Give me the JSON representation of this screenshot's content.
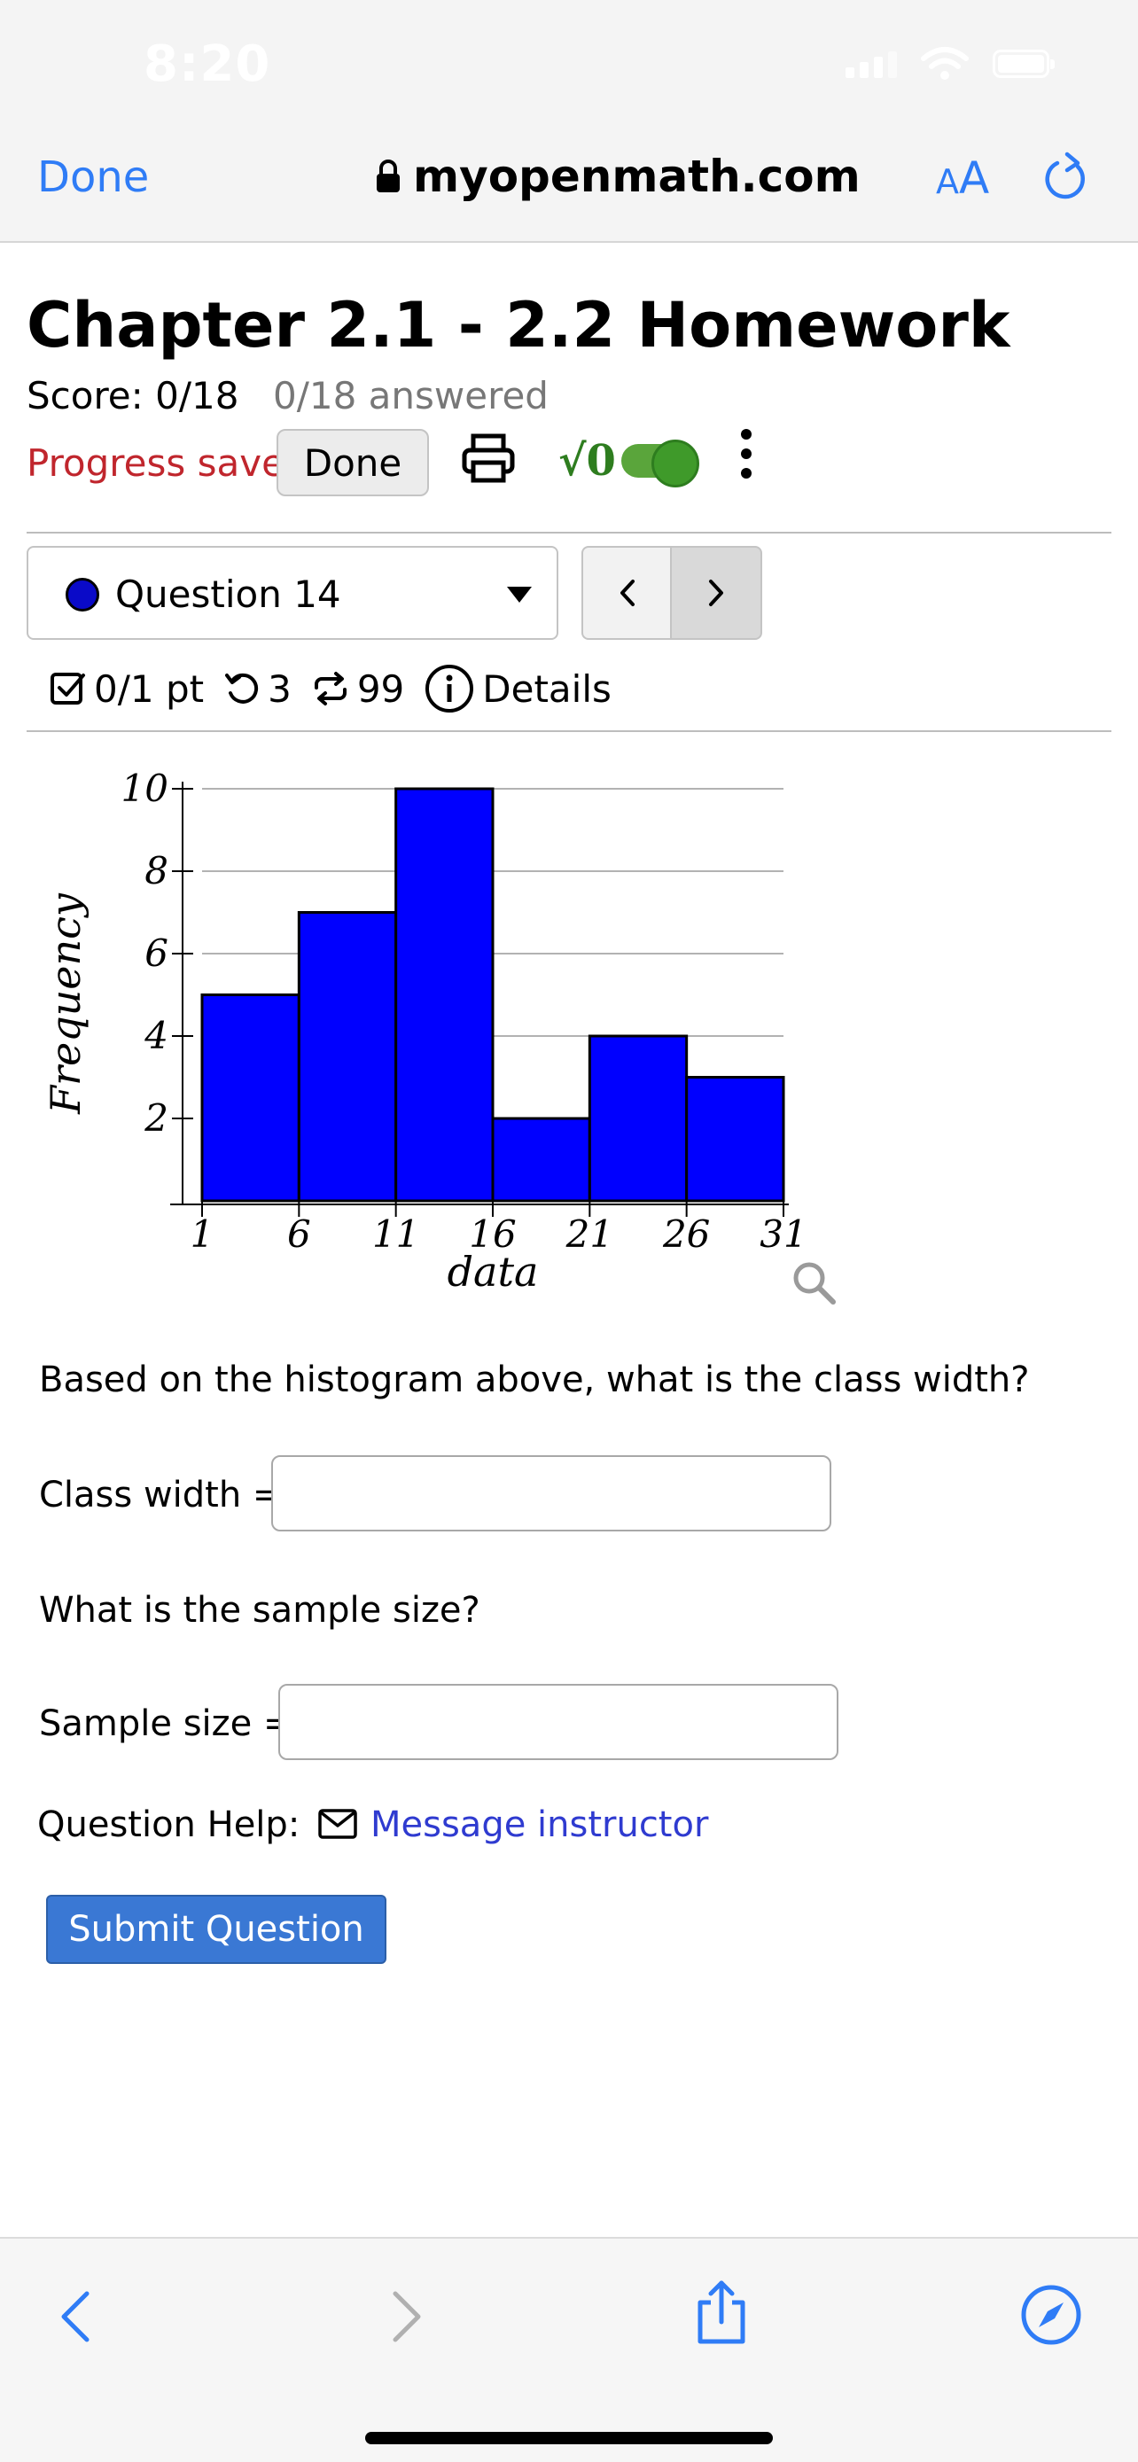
{
  "status_bar": {
    "time": "8:20"
  },
  "browser": {
    "done_label": "Done",
    "url": "myopenmath.com",
    "aa_small": "A",
    "aa_big": "A"
  },
  "page": {
    "title": "Chapter 2.1 - 2.2 Homework",
    "score": "Score: 0/18",
    "answered": "0/18 answered",
    "progress_saved": "Progress saved",
    "done_button": "Done"
  },
  "question_nav": {
    "current": "Question 14",
    "prev_symbol": "<",
    "next_symbol": ">"
  },
  "question_meta": {
    "points": "0/1 pt",
    "retries": "3",
    "attempts": "99",
    "details": "Details"
  },
  "chart_data": {
    "type": "bar",
    "title": "",
    "xlabel": "data",
    "ylabel": "Frequency",
    "bin_edges": [
      1,
      6,
      11,
      16,
      21,
      26,
      31
    ],
    "x_tick_labels": [
      "1",
      "6",
      "11",
      "16",
      "21",
      "26",
      "31"
    ],
    "values": [
      5,
      7,
      10,
      2,
      4,
      3
    ],
    "y_ticks": [
      2,
      4,
      6,
      8,
      10
    ],
    "y_tick_labels": [
      "2",
      "4",
      "6",
      "8",
      "10"
    ],
    "ylim": [
      0,
      10
    ],
    "bar_color": "#0000ff",
    "grid": true
  },
  "question": {
    "prompt": "Based on the histogram above, what is the class width?",
    "class_width_label": "Class width =",
    "class_width_value": "",
    "sample_size_prompt": "What is the sample size?",
    "sample_size_label": "Sample size =",
    "sample_size_value": "",
    "help_label": "Question Help:",
    "message_link": "Message instructor",
    "submit_label": "Submit Question"
  },
  "colors": {
    "accent": "#2f7cf6",
    "error": "#c0262d",
    "submit": "#3a78d4",
    "link": "#2f3bd0"
  }
}
